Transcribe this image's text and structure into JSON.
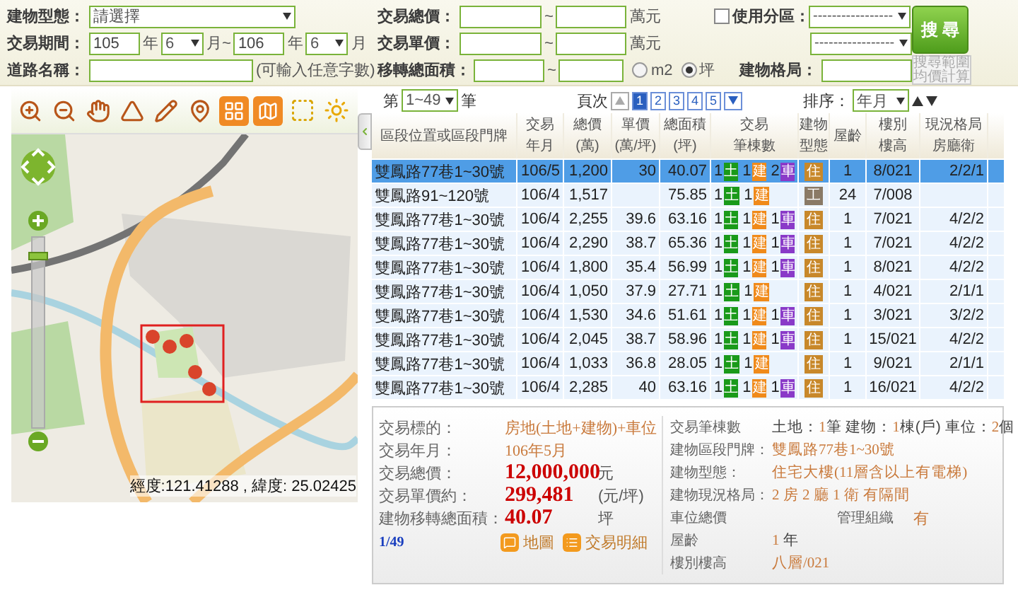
{
  "search_form": {
    "building_type": {
      "label": "建物型態：",
      "value": "請選擇"
    },
    "period": {
      "label": "交易期間：",
      "from_year": "105",
      "year_unit": "年",
      "from_month": "6",
      "range_mark": "月~",
      "to_year": "106",
      "to_year_unit": "年",
      "to_month": "6",
      "month_unit": "月"
    },
    "road": {
      "label": "道路名稱：",
      "hint": "(可輸入任意字數)"
    },
    "total_price": {
      "label": "交易總價：",
      "separator": "~",
      "unit": "萬元"
    },
    "unit_price": {
      "label": "交易單價：",
      "separator": "~",
      "unit": "萬元"
    },
    "area": {
      "label": "移轉總面積：",
      "separator": "~",
      "units": [
        {
          "label": "m2",
          "selected": false
        },
        {
          "label": "坪",
          "selected": true
        }
      ]
    },
    "zoning": {
      "label": "使用分區：",
      "checked": false,
      "value": "-----------------"
    },
    "zoning_detail": {
      "value": "-----------------"
    },
    "layout": {
      "label": "建物格局："
    },
    "search_button": "搜 尋",
    "average_button": {
      "label": "搜尋範圍均價計算",
      "disabled": true
    }
  },
  "map": {
    "zoom": {
      "level": 0.92
    },
    "coordinates": "經度:121.41288 , 緯度: 25.02425"
  },
  "pager": {
    "prefix": "第",
    "range": "1~49",
    "suffix": "筆",
    "pages_label": "頁次",
    "pages": [
      {
        "label": "1",
        "selected": true
      },
      {
        "label": "2",
        "selected": false
      },
      {
        "label": "3",
        "selected": false
      },
      {
        "label": "4",
        "selected": false
      },
      {
        "label": "5",
        "selected": false
      }
    ],
    "sort_label": "排序：",
    "sort_value": "年月"
  },
  "table": {
    "columns": [
      [
        "區段位置或區段門牌"
      ],
      [
        "交易",
        "年月"
      ],
      [
        "總價",
        "(萬)"
      ],
      [
        "單價",
        "(萬/坪)"
      ],
      [
        "總面積",
        "(坪)"
      ],
      [
        "交易",
        "筆棟數"
      ],
      [
        "建物",
        "型態"
      ],
      [
        "屋齡"
      ],
      [
        "樓別",
        "樓高"
      ],
      [
        "現況格局",
        "房廳衛"
      ]
    ],
    "rows": [
      {
        "address": "雙鳳路77巷1~30號",
        "date": "106/5",
        "total": "1,200",
        "unit": "30",
        "area": "40.07",
        "transfers": [
          {
            "count": "1",
            "label": "土",
            "kind": "land"
          },
          {
            "count": "1",
            "label": "建",
            "kind": "building"
          },
          {
            "count": "2",
            "label": "車",
            "kind": "parking"
          }
        ],
        "building_type": {
          "label": "住",
          "color": "#c8882a"
        },
        "age": "1",
        "floor": "8/021",
        "layout": "2/2/1",
        "selected": true
      },
      {
        "address": "雙鳳路91~120號",
        "date": "106/4",
        "total": "1,517",
        "area": "75.85",
        "transfers": [
          {
            "count": "1",
            "label": "土",
            "kind": "land"
          },
          {
            "count": "1",
            "label": "建",
            "kind": "building"
          }
        ],
        "building_type": {
          "label": "工",
          "color": "#8a7a66"
        },
        "age": "24",
        "floor": "7/008",
        "selected": false
      },
      {
        "address": "雙鳳路77巷1~30號",
        "date": "106/4",
        "total": "2,255",
        "unit": "39.6",
        "area": "63.16",
        "transfers": [
          {
            "count": "1",
            "label": "土",
            "kind": "land"
          },
          {
            "count": "1",
            "label": "建",
            "kind": "building"
          },
          {
            "count": "1",
            "label": "車",
            "kind": "parking"
          }
        ],
        "building_type": {
          "label": "住",
          "color": "#c8882a"
        },
        "age": "1",
        "floor": "7/021",
        "layout": "4/2/2",
        "selected": false
      },
      {
        "address": "雙鳳路77巷1~30號",
        "date": "106/4",
        "total": "2,290",
        "unit": "38.7",
        "area": "65.36",
        "transfers": [
          {
            "count": "1",
            "label": "土",
            "kind": "land"
          },
          {
            "count": "1",
            "label": "建",
            "kind": "building"
          },
          {
            "count": "1",
            "label": "車",
            "kind": "parking"
          }
        ],
        "building_type": {
          "label": "住",
          "color": "#c8882a"
        },
        "age": "1",
        "floor": "7/021",
        "layout": "4/2/2",
        "selected": false
      },
      {
        "address": "雙鳳路77巷1~30號",
        "date": "106/4",
        "total": "1,800",
        "unit": "35.4",
        "area": "56.99",
        "transfers": [
          {
            "count": "1",
            "label": "土",
            "kind": "land"
          },
          {
            "count": "1",
            "label": "建",
            "kind": "building"
          },
          {
            "count": "1",
            "label": "車",
            "kind": "parking"
          }
        ],
        "building_type": {
          "label": "住",
          "color": "#c8882a"
        },
        "age": "1",
        "floor": "8/021",
        "layout": "4/2/2",
        "selected": false
      },
      {
        "address": "雙鳳路77巷1~30號",
        "date": "106/4",
        "total": "1,050",
        "unit": "37.9",
        "area": "27.71",
        "transfers": [
          {
            "count": "1",
            "label": "土",
            "kind": "land"
          },
          {
            "count": "1",
            "label": "建",
            "kind": "building"
          }
        ],
        "building_type": {
          "label": "住",
          "color": "#c8882a"
        },
        "age": "1",
        "floor": "4/021",
        "layout": "2/1/1",
        "selected": false
      },
      {
        "address": "雙鳳路77巷1~30號",
        "date": "106/4",
        "total": "1,530",
        "unit": "34.6",
        "area": "51.61",
        "transfers": [
          {
            "count": "1",
            "label": "土",
            "kind": "land"
          },
          {
            "count": "1",
            "label": "建",
            "kind": "building"
          },
          {
            "count": "1",
            "label": "車",
            "kind": "parking"
          }
        ],
        "building_type": {
          "label": "住",
          "color": "#c8882a"
        },
        "age": "1",
        "floor": "3/021",
        "layout": "3/2/2",
        "selected": false
      },
      {
        "address": "雙鳳路77巷1~30號",
        "date": "106/4",
        "total": "2,045",
        "unit": "38.7",
        "area": "58.96",
        "transfers": [
          {
            "count": "1",
            "label": "土",
            "kind": "land"
          },
          {
            "count": "1",
            "label": "建",
            "kind": "building"
          },
          {
            "count": "1",
            "label": "車",
            "kind": "parking"
          }
        ],
        "building_type": {
          "label": "住",
          "color": "#c8882a"
        },
        "age": "1",
        "floor": "15/021",
        "layout": "4/2/2",
        "selected": false
      },
      {
        "address": "雙鳳路77巷1~30號",
        "date": "106/4",
        "total": "1,033",
        "unit": "36.8",
        "area": "28.05",
        "transfers": [
          {
            "count": "1",
            "label": "土",
            "kind": "land"
          },
          {
            "count": "1",
            "label": "建",
            "kind": "building"
          }
        ],
        "building_type": {
          "label": "住",
          "color": "#c8882a"
        },
        "age": "1",
        "floor": "9/021",
        "layout": "2/1/1",
        "selected": false
      },
      {
        "address": "雙鳳路77巷1~30號",
        "date": "106/4",
        "total": "2,285",
        "unit": "40",
        "area": "63.16",
        "transfers": [
          {
            "count": "1",
            "label": "土",
            "kind": "land"
          },
          {
            "count": "1",
            "label": "建",
            "kind": "building"
          },
          {
            "count": "1",
            "label": "車",
            "kind": "parking"
          }
        ],
        "building_type": {
          "label": "住",
          "color": "#c8882a"
        },
        "age": "1",
        "floor": "16/021",
        "layout": "4/2/2",
        "selected": false
      }
    ]
  },
  "detail": {
    "left": [
      {
        "label": "交易標的：",
        "value": "房地(土地+建物)+車位",
        "kind": "plain"
      },
      {
        "label": "交易年月：",
        "value": "106年5月",
        "kind": "plain"
      },
      {
        "label": "交易總價：",
        "value": "12,000,000",
        "unit": "元",
        "kind": "big"
      },
      {
        "label": "交易單價約：",
        "value": "299,481",
        "unit": "(元/坪)",
        "kind": "big"
      },
      {
        "label": "建物移轉總面積：",
        "value": "40.07",
        "unit": "坪",
        "kind": "big"
      }
    ],
    "index": "1/49",
    "links": [
      {
        "label": "地圖",
        "kind": "map"
      },
      {
        "label": "交易明細",
        "kind": "list"
      }
    ],
    "right": [
      {
        "label": "交易筆棟數",
        "value": [
          {
            "text": "土地：",
            "accent": false
          },
          {
            "text": "1",
            "accent": true
          },
          {
            "text": "筆 建物：",
            "accent": false
          },
          {
            "text": "1",
            "accent": true
          },
          {
            "text": "棟(戶) 車位：",
            "accent": false
          },
          {
            "text": "2",
            "accent": true
          },
          {
            "text": "個",
            "accent": false
          }
        ]
      },
      {
        "label": "建物區段門牌：",
        "value": [
          {
            "text": "雙鳳路77巷1~30號",
            "accent": true
          }
        ]
      },
      {
        "label": "建物型態：",
        "value": [
          {
            "text": "住宅大樓(11層含以上有電梯)",
            "accent": true
          }
        ]
      },
      {
        "label": "建物現況格局：",
        "value": [
          {
            "text": "2 房 2 廳 1 衛 有隔間",
            "accent": true
          }
        ]
      },
      {
        "label": "車位總價",
        "extra_label": "管理組織",
        "extra_value": "有"
      },
      {
        "label": "屋齡",
        "value": [
          {
            "text": "1",
            "accent": true
          },
          {
            "text": " 年",
            "accent": false
          }
        ]
      },
      {
        "label": "樓別樓高",
        "value": [
          {
            "text": "八層/021",
            "accent": true
          }
        ]
      }
    ]
  }
}
